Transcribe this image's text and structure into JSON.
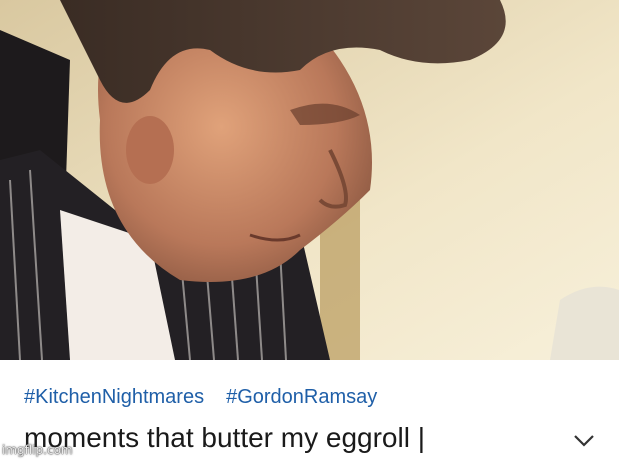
{
  "post": {
    "hashtags": [
      "#KitchenNightmares",
      "#GordonRamsay"
    ],
    "title": "moments that butter my eggroll",
    "cursor": "|",
    "expand_icon": "chevron-down-icon"
  },
  "watermark": {
    "text": "imgflip.com"
  }
}
